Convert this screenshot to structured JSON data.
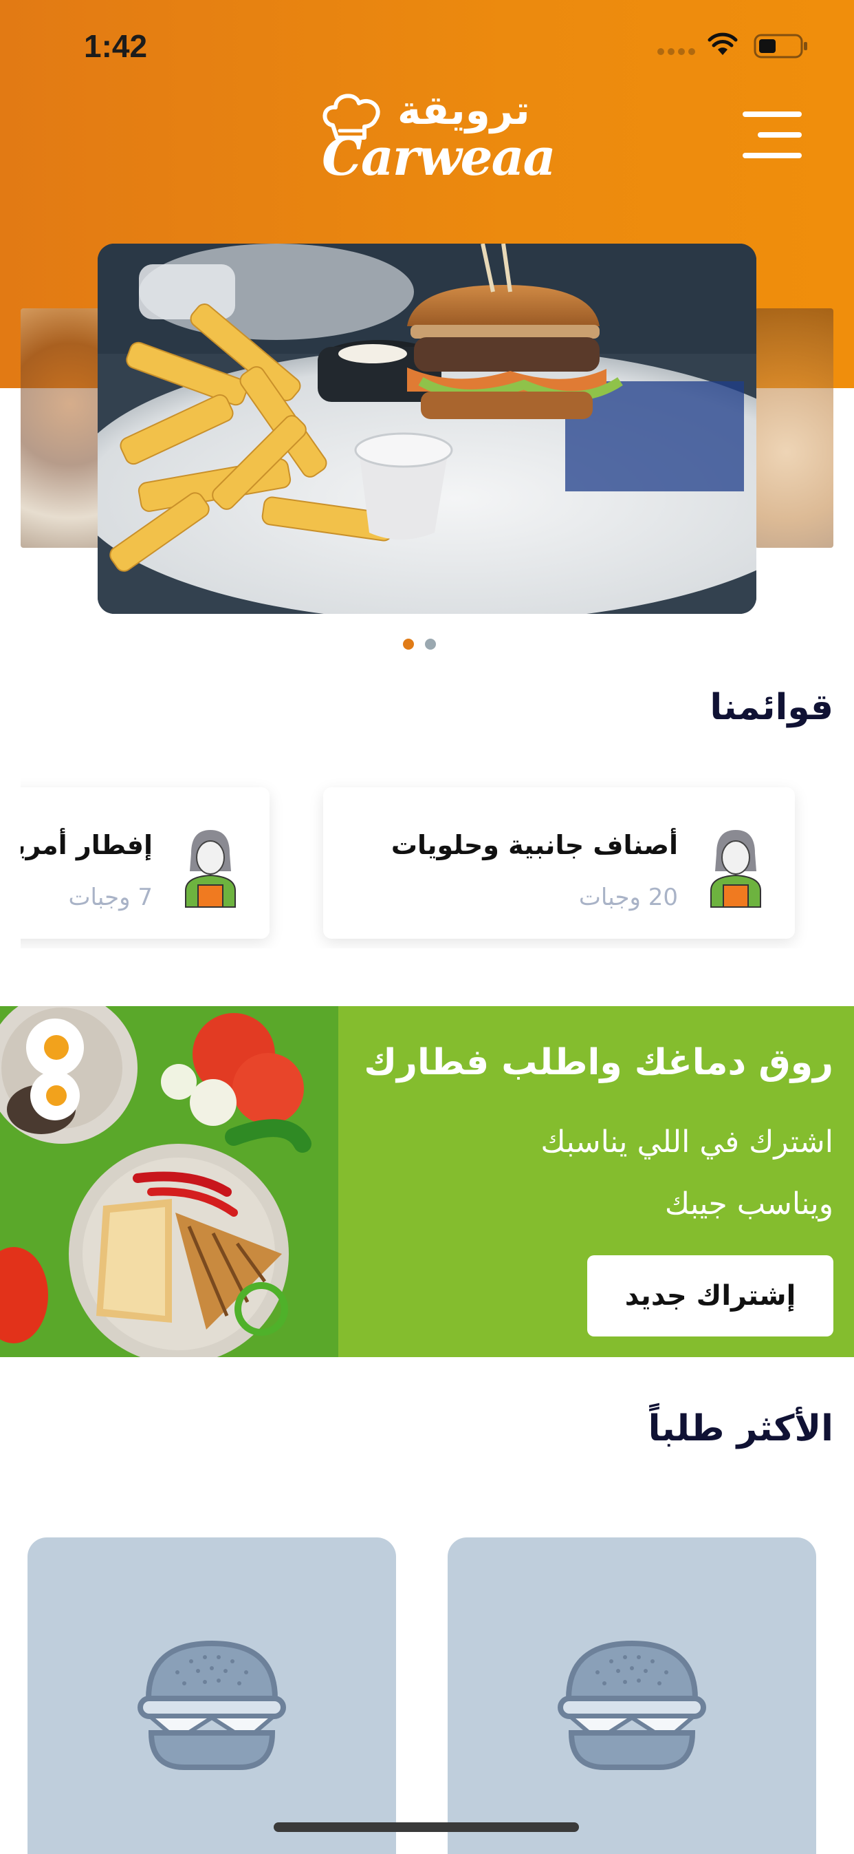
{
  "status_bar": {
    "time": "1:42"
  },
  "header": {
    "logo_arabic": "ترويقة",
    "logo_latin": "Carweaa",
    "accent_color": "#e8820f"
  },
  "carousel": {
    "active_index": 0,
    "dot_colors": [
      "#e07b16",
      "#9aa8b0"
    ]
  },
  "menus": {
    "title": "قوائمنا",
    "items": [
      {
        "title": "أصناف جانبية وحلويات",
        "count": "20 وجبات"
      },
      {
        "title": "إفطار أمريكي",
        "count": "7 وجبات"
      }
    ]
  },
  "promo": {
    "title": "روق دماغك واطلب فطارك",
    "line1": "اشترك في اللي يناسبك",
    "line2": "ويناسب جيبك",
    "button_label": "إشتراك جديد",
    "background": "#84bd2e"
  },
  "popular": {
    "title": "الأكثر طلباً",
    "placeholder_icon": "burger-icon"
  }
}
